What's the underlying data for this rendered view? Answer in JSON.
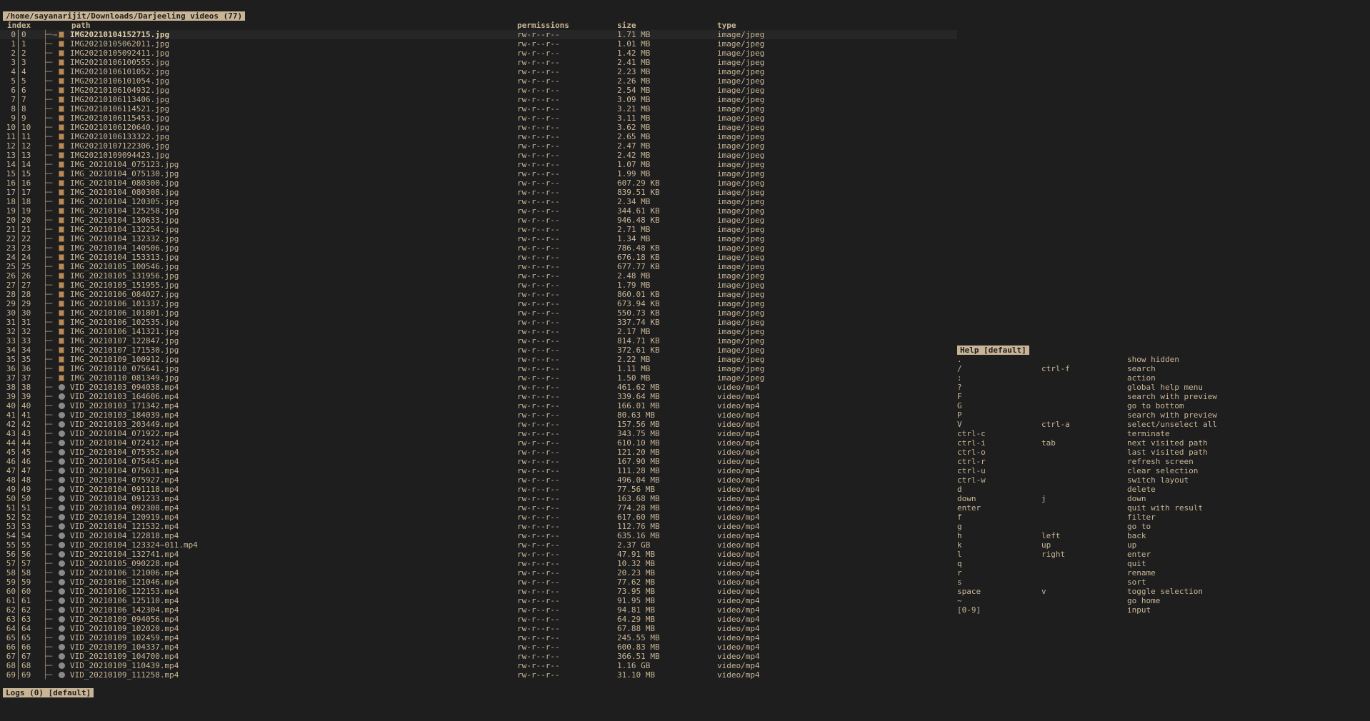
{
  "title": "/home/sayanarijit/Downloads/Darjeeling videos (77)",
  "columns": {
    "index": "index",
    "path": "path",
    "permissions": "permissions",
    "size": "size",
    "type": "type"
  },
  "tree_branch": "├─",
  "focus_arrow": "→",
  "files": [
    {
      "i": "0",
      "r": "0",
      "name": "IMG20210104152715.jpg",
      "perm": "rw-r--r--",
      "size": "1.71 MB",
      "type": "image/jpeg",
      "kind": "image"
    },
    {
      "i": "1",
      "r": "1",
      "name": "IMG20210105062011.jpg",
      "perm": "rw-r--r--",
      "size": "1.01 MB",
      "type": "image/jpeg",
      "kind": "image"
    },
    {
      "i": "2",
      "r": "2",
      "name": "IMG20210105092411.jpg",
      "perm": "rw-r--r--",
      "size": "1.42 MB",
      "type": "image/jpeg",
      "kind": "image"
    },
    {
      "i": "3",
      "r": "3",
      "name": "IMG20210106100555.jpg",
      "perm": "rw-r--r--",
      "size": "2.41 MB",
      "type": "image/jpeg",
      "kind": "image"
    },
    {
      "i": "4",
      "r": "4",
      "name": "IMG20210106101052.jpg",
      "perm": "rw-r--r--",
      "size": "2.23 MB",
      "type": "image/jpeg",
      "kind": "image"
    },
    {
      "i": "5",
      "r": "5",
      "name": "IMG20210106101054.jpg",
      "perm": "rw-r--r--",
      "size": "2.26 MB",
      "type": "image/jpeg",
      "kind": "image"
    },
    {
      "i": "6",
      "r": "6",
      "name": "IMG20210106104932.jpg",
      "perm": "rw-r--r--",
      "size": "2.54 MB",
      "type": "image/jpeg",
      "kind": "image"
    },
    {
      "i": "7",
      "r": "7",
      "name": "IMG20210106113406.jpg",
      "perm": "rw-r--r--",
      "size": "3.09 MB",
      "type": "image/jpeg",
      "kind": "image"
    },
    {
      "i": "8",
      "r": "8",
      "name": "IMG20210106114521.jpg",
      "perm": "rw-r--r--",
      "size": "3.21 MB",
      "type": "image/jpeg",
      "kind": "image"
    },
    {
      "i": "9",
      "r": "9",
      "name": "IMG20210106115453.jpg",
      "perm": "rw-r--r--",
      "size": "3.11 MB",
      "type": "image/jpeg",
      "kind": "image"
    },
    {
      "i": "10",
      "r": "10",
      "name": "IMG20210106120640.jpg",
      "perm": "rw-r--r--",
      "size": "3.62 MB",
      "type": "image/jpeg",
      "kind": "image"
    },
    {
      "i": "11",
      "r": "11",
      "name": "IMG20210106133322.jpg",
      "perm": "rw-r--r--",
      "size": "2.65 MB",
      "type": "image/jpeg",
      "kind": "image"
    },
    {
      "i": "12",
      "r": "12",
      "name": "IMG20210107122306.jpg",
      "perm": "rw-r--r--",
      "size": "2.47 MB",
      "type": "image/jpeg",
      "kind": "image"
    },
    {
      "i": "13",
      "r": "13",
      "name": "IMG20210109094423.jpg",
      "perm": "rw-r--r--",
      "size": "2.42 MB",
      "type": "image/jpeg",
      "kind": "image"
    },
    {
      "i": "14",
      "r": "14",
      "name": "IMG_20210104_075123.jpg",
      "perm": "rw-r--r--",
      "size": "1.07 MB",
      "type": "image/jpeg",
      "kind": "image"
    },
    {
      "i": "15",
      "r": "15",
      "name": "IMG_20210104_075130.jpg",
      "perm": "rw-r--r--",
      "size": "1.99 MB",
      "type": "image/jpeg",
      "kind": "image"
    },
    {
      "i": "16",
      "r": "16",
      "name": "IMG_20210104_080300.jpg",
      "perm": "rw-r--r--",
      "size": "607.29 KB",
      "type": "image/jpeg",
      "kind": "image"
    },
    {
      "i": "17",
      "r": "17",
      "name": "IMG_20210104_080308.jpg",
      "perm": "rw-r--r--",
      "size": "839.51 KB",
      "type": "image/jpeg",
      "kind": "image"
    },
    {
      "i": "18",
      "r": "18",
      "name": "IMG_20210104_120305.jpg",
      "perm": "rw-r--r--",
      "size": "2.34 MB",
      "type": "image/jpeg",
      "kind": "image"
    },
    {
      "i": "19",
      "r": "19",
      "name": "IMG_20210104_125258.jpg",
      "perm": "rw-r--r--",
      "size": "344.61 KB",
      "type": "image/jpeg",
      "kind": "image"
    },
    {
      "i": "20",
      "r": "20",
      "name": "IMG_20210104_130633.jpg",
      "perm": "rw-r--r--",
      "size": "946.48 KB",
      "type": "image/jpeg",
      "kind": "image"
    },
    {
      "i": "21",
      "r": "21",
      "name": "IMG_20210104_132254.jpg",
      "perm": "rw-r--r--",
      "size": "2.71 MB",
      "type": "image/jpeg",
      "kind": "image"
    },
    {
      "i": "22",
      "r": "22",
      "name": "IMG_20210104_132332.jpg",
      "perm": "rw-r--r--",
      "size": "1.34 MB",
      "type": "image/jpeg",
      "kind": "image"
    },
    {
      "i": "23",
      "r": "23",
      "name": "IMG_20210104_140506.jpg",
      "perm": "rw-r--r--",
      "size": "786.48 KB",
      "type": "image/jpeg",
      "kind": "image"
    },
    {
      "i": "24",
      "r": "24",
      "name": "IMG_20210104_153313.jpg",
      "perm": "rw-r--r--",
      "size": "676.18 KB",
      "type": "image/jpeg",
      "kind": "image"
    },
    {
      "i": "25",
      "r": "25",
      "name": "IMG_20210105_100546.jpg",
      "perm": "rw-r--r--",
      "size": "677.77 KB",
      "type": "image/jpeg",
      "kind": "image"
    },
    {
      "i": "26",
      "r": "26",
      "name": "IMG_20210105_131956.jpg",
      "perm": "rw-r--r--",
      "size": "2.48 MB",
      "type": "image/jpeg",
      "kind": "image"
    },
    {
      "i": "27",
      "r": "27",
      "name": "IMG_20210105_151955.jpg",
      "perm": "rw-r--r--",
      "size": "1.79 MB",
      "type": "image/jpeg",
      "kind": "image"
    },
    {
      "i": "28",
      "r": "28",
      "name": "IMG_20210106_084027.jpg",
      "perm": "rw-r--r--",
      "size": "860.01 KB",
      "type": "image/jpeg",
      "kind": "image"
    },
    {
      "i": "29",
      "r": "29",
      "name": "IMG_20210106_101337.jpg",
      "perm": "rw-r--r--",
      "size": "673.94 KB",
      "type": "image/jpeg",
      "kind": "image"
    },
    {
      "i": "30",
      "r": "30",
      "name": "IMG_20210106_101801.jpg",
      "perm": "rw-r--r--",
      "size": "550.73 KB",
      "type": "image/jpeg",
      "kind": "image"
    },
    {
      "i": "31",
      "r": "31",
      "name": "IMG_20210106_102535.jpg",
      "perm": "rw-r--r--",
      "size": "337.74 KB",
      "type": "image/jpeg",
      "kind": "image"
    },
    {
      "i": "32",
      "r": "32",
      "name": "IMG_20210106_141321.jpg",
      "perm": "rw-r--r--",
      "size": "2.17 MB",
      "type": "image/jpeg",
      "kind": "image"
    },
    {
      "i": "33",
      "r": "33",
      "name": "IMG_20210107_122847.jpg",
      "perm": "rw-r--r--",
      "size": "814.71 KB",
      "type": "image/jpeg",
      "kind": "image"
    },
    {
      "i": "34",
      "r": "34",
      "name": "IMG_20210107_171530.jpg",
      "perm": "rw-r--r--",
      "size": "372.61 KB",
      "type": "image/jpeg",
      "kind": "image"
    },
    {
      "i": "35",
      "r": "35",
      "name": "IMG_20210109_100912.jpg",
      "perm": "rw-r--r--",
      "size": "2.22 MB",
      "type": "image/jpeg",
      "kind": "image"
    },
    {
      "i": "36",
      "r": "36",
      "name": "IMG_20210110_075641.jpg",
      "perm": "rw-r--r--",
      "size": "1.11 MB",
      "type": "image/jpeg",
      "kind": "image"
    },
    {
      "i": "37",
      "r": "37",
      "name": "IMG_20210110_081349.jpg",
      "perm": "rw-r--r--",
      "size": "1.50 MB",
      "type": "image/jpeg",
      "kind": "image"
    },
    {
      "i": "38",
      "r": "38",
      "name": "VID_20210103_094038.mp4",
      "perm": "rw-r--r--",
      "size": "461.62 MB",
      "type": "video/mp4",
      "kind": "video"
    },
    {
      "i": "39",
      "r": "39",
      "name": "VID_20210103_164606.mp4",
      "perm": "rw-r--r--",
      "size": "339.64 MB",
      "type": "video/mp4",
      "kind": "video"
    },
    {
      "i": "40",
      "r": "40",
      "name": "VID_20210103_171342.mp4",
      "perm": "rw-r--r--",
      "size": "166.01 MB",
      "type": "video/mp4",
      "kind": "video"
    },
    {
      "i": "41",
      "r": "41",
      "name": "VID_20210103_184039.mp4",
      "perm": "rw-r--r--",
      "size": "80.63 MB",
      "type": "video/mp4",
      "kind": "video"
    },
    {
      "i": "42",
      "r": "42",
      "name": "VID_20210103_203449.mp4",
      "perm": "rw-r--r--",
      "size": "157.56 MB",
      "type": "video/mp4",
      "kind": "video"
    },
    {
      "i": "43",
      "r": "43",
      "name": "VID_20210104_071922.mp4",
      "perm": "rw-r--r--",
      "size": "343.75 MB",
      "type": "video/mp4",
      "kind": "video"
    },
    {
      "i": "44",
      "r": "44",
      "name": "VID_20210104_072412.mp4",
      "perm": "rw-r--r--",
      "size": "610.10 MB",
      "type": "video/mp4",
      "kind": "video"
    },
    {
      "i": "45",
      "r": "45",
      "name": "VID_20210104_075352.mp4",
      "perm": "rw-r--r--",
      "size": "121.20 MB",
      "type": "video/mp4",
      "kind": "video"
    },
    {
      "i": "46",
      "r": "46",
      "name": "VID_20210104_075445.mp4",
      "perm": "rw-r--r--",
      "size": "167.90 MB",
      "type": "video/mp4",
      "kind": "video"
    },
    {
      "i": "47",
      "r": "47",
      "name": "VID_20210104_075631.mp4",
      "perm": "rw-r--r--",
      "size": "111.28 MB",
      "type": "video/mp4",
      "kind": "video"
    },
    {
      "i": "48",
      "r": "48",
      "name": "VID_20210104_075927.mp4",
      "perm": "rw-r--r--",
      "size": "496.04 MB",
      "type": "video/mp4",
      "kind": "video"
    },
    {
      "i": "49",
      "r": "49",
      "name": "VID_20210104_091118.mp4",
      "perm": "rw-r--r--",
      "size": "77.56 MB",
      "type": "video/mp4",
      "kind": "video"
    },
    {
      "i": "50",
      "r": "50",
      "name": "VID_20210104_091233.mp4",
      "perm": "rw-r--r--",
      "size": "163.68 MB",
      "type": "video/mp4",
      "kind": "video"
    },
    {
      "i": "51",
      "r": "51",
      "name": "VID_20210104_092308.mp4",
      "perm": "rw-r--r--",
      "size": "774.28 MB",
      "type": "video/mp4",
      "kind": "video"
    },
    {
      "i": "52",
      "r": "52",
      "name": "VID_20210104_120919.mp4",
      "perm": "rw-r--r--",
      "size": "617.60 MB",
      "type": "video/mp4",
      "kind": "video"
    },
    {
      "i": "53",
      "r": "53",
      "name": "VID_20210104_121532.mp4",
      "perm": "rw-r--r--",
      "size": "112.76 MB",
      "type": "video/mp4",
      "kind": "video"
    },
    {
      "i": "54",
      "r": "54",
      "name": "VID_20210104_122818.mp4",
      "perm": "rw-r--r--",
      "size": "635.16 MB",
      "type": "video/mp4",
      "kind": "video"
    },
    {
      "i": "55",
      "r": "55",
      "name": "VID_20210104_123324~011.mp4",
      "perm": "rw-r--r--",
      "size": "2.37 GB",
      "type": "video/mp4",
      "kind": "video"
    },
    {
      "i": "56",
      "r": "56",
      "name": "VID_20210104_132741.mp4",
      "perm": "rw-r--r--",
      "size": "47.91 MB",
      "type": "video/mp4",
      "kind": "video"
    },
    {
      "i": "57",
      "r": "57",
      "name": "VID_20210105_090228.mp4",
      "perm": "rw-r--r--",
      "size": "10.32 MB",
      "type": "video/mp4",
      "kind": "video"
    },
    {
      "i": "58",
      "r": "58",
      "name": "VID_20210106_121006.mp4",
      "perm": "rw-r--r--",
      "size": "20.23 MB",
      "type": "video/mp4",
      "kind": "video"
    },
    {
      "i": "59",
      "r": "59",
      "name": "VID_20210106_121046.mp4",
      "perm": "rw-r--r--",
      "size": "77.62 MB",
      "type": "video/mp4",
      "kind": "video"
    },
    {
      "i": "60",
      "r": "60",
      "name": "VID_20210106_122153.mp4",
      "perm": "rw-r--r--",
      "size": "73.95 MB",
      "type": "video/mp4",
      "kind": "video"
    },
    {
      "i": "61",
      "r": "61",
      "name": "VID_20210106_125110.mp4",
      "perm": "rw-r--r--",
      "size": "91.95 MB",
      "type": "video/mp4",
      "kind": "video"
    },
    {
      "i": "62",
      "r": "62",
      "name": "VID_20210106_142304.mp4",
      "perm": "rw-r--r--",
      "size": "94.81 MB",
      "type": "video/mp4",
      "kind": "video"
    },
    {
      "i": "63",
      "r": "63",
      "name": "VID_20210109_094056.mp4",
      "perm": "rw-r--r--",
      "size": "64.29 MB",
      "type": "video/mp4",
      "kind": "video"
    },
    {
      "i": "64",
      "r": "64",
      "name": "VID_20210109_102020.mp4",
      "perm": "rw-r--r--",
      "size": "67.88 MB",
      "type": "video/mp4",
      "kind": "video"
    },
    {
      "i": "65",
      "r": "65",
      "name": "VID_20210109_102459.mp4",
      "perm": "rw-r--r--",
      "size": "245.55 MB",
      "type": "video/mp4",
      "kind": "video"
    },
    {
      "i": "66",
      "r": "66",
      "name": "VID_20210109_104337.mp4",
      "perm": "rw-r--r--",
      "size": "600.83 MB",
      "type": "video/mp4",
      "kind": "video"
    },
    {
      "i": "67",
      "r": "67",
      "name": "VID_20210109_104700.mp4",
      "perm": "rw-r--r--",
      "size": "366.51 MB",
      "type": "video/mp4",
      "kind": "video"
    },
    {
      "i": "68",
      "r": "68",
      "name": "VID_20210109_110439.mp4",
      "perm": "rw-r--r--",
      "size": "1.16 GB",
      "type": "video/mp4",
      "kind": "video"
    },
    {
      "i": "69",
      "r": "69",
      "name": "VID_20210109_111258.mp4",
      "perm": "rw-r--r--",
      "size": "31.10 MB",
      "type": "video/mp4",
      "kind": "video"
    }
  ],
  "help_title": "Help [default]",
  "help": [
    {
      "k1": ".",
      "k2": "",
      "act": "show hidden"
    },
    {
      "k1": "/",
      "k2": "ctrl-f",
      "act": "search"
    },
    {
      "k1": ":",
      "k2": "",
      "act": "action"
    },
    {
      "k1": "?",
      "k2": "",
      "act": "global help menu"
    },
    {
      "k1": "F",
      "k2": "",
      "act": "search with preview"
    },
    {
      "k1": "G",
      "k2": "",
      "act": "go to bottom"
    },
    {
      "k1": "P",
      "k2": "",
      "act": "search with preview"
    },
    {
      "k1": "V",
      "k2": "ctrl-a",
      "act": "select/unselect all"
    },
    {
      "k1": "ctrl-c",
      "k2": "",
      "act": "terminate"
    },
    {
      "k1": "ctrl-i",
      "k2": "tab",
      "act": "next visited path"
    },
    {
      "k1": "ctrl-o",
      "k2": "",
      "act": "last visited path"
    },
    {
      "k1": "ctrl-r",
      "k2": "",
      "act": "refresh screen"
    },
    {
      "k1": "ctrl-u",
      "k2": "",
      "act": "clear selection"
    },
    {
      "k1": "ctrl-w",
      "k2": "",
      "act": "switch layout"
    },
    {
      "k1": "d",
      "k2": "",
      "act": "delete"
    },
    {
      "k1": "down",
      "k2": "j",
      "act": "down"
    },
    {
      "k1": "enter",
      "k2": "",
      "act": "quit with result"
    },
    {
      "k1": "f",
      "k2": "",
      "act": "filter"
    },
    {
      "k1": "g",
      "k2": "",
      "act": "go to"
    },
    {
      "k1": "h",
      "k2": "left",
      "act": "back"
    },
    {
      "k1": "k",
      "k2": "up",
      "act": "up"
    },
    {
      "k1": "l",
      "k2": "right",
      "act": "enter"
    },
    {
      "k1": "q",
      "k2": "",
      "act": "quit"
    },
    {
      "k1": "r",
      "k2": "",
      "act": "rename"
    },
    {
      "k1": "s",
      "k2": "",
      "act": "sort"
    },
    {
      "k1": "space",
      "k2": "v",
      "act": "toggle selection"
    },
    {
      "k1": "~",
      "k2": "",
      "act": "go home"
    },
    {
      "k1": "[0-9]",
      "k2": "",
      "act": "input"
    }
  ],
  "logs_title": "Logs (0) [default]"
}
